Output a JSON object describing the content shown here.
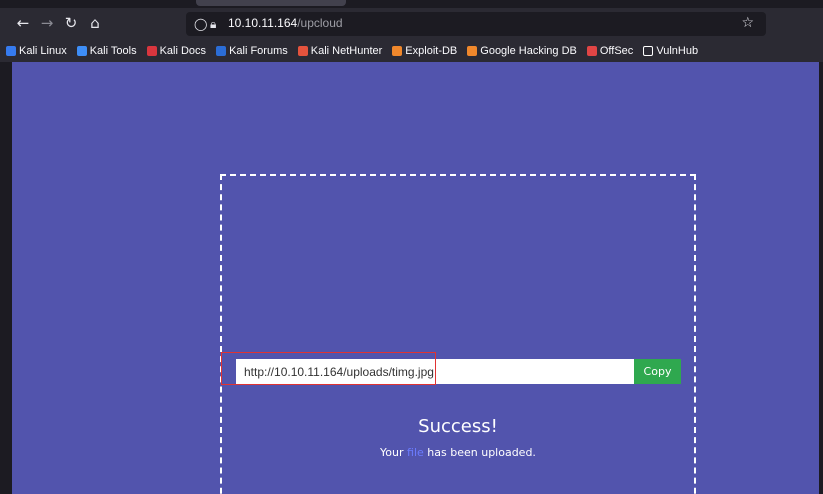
{
  "browser": {
    "url_host": "10.10.11.164",
    "url_path": "/upcloud",
    "nav_icons": [
      "arrow-left-icon",
      "arrow-right-icon",
      "reload-icon",
      "home-icon"
    ]
  },
  "bookmarks": [
    {
      "label": "Kali Linux",
      "color": "#367bf0"
    },
    {
      "label": "Kali Tools",
      "color": "#3e8ef7"
    },
    {
      "label": "Kali Docs",
      "color": "#d9363e"
    },
    {
      "label": "Kali Forums",
      "color": "#2b6dd6"
    },
    {
      "label": "Kali NetHunter",
      "color": "#e5533d"
    },
    {
      "label": "Exploit-DB",
      "color": "#f0882c"
    },
    {
      "label": "Google Hacking DB",
      "color": "#f0882c"
    },
    {
      "label": "OffSec",
      "color": "#e04545"
    },
    {
      "label": "VulnHub",
      "color": "#ffffff"
    }
  ],
  "page": {
    "background": "#5254ad",
    "title": "Success!",
    "message_before": "Your",
    "message_link": "file",
    "message_after": "has been uploaded.",
    "uploaded_url": "http://10.10.11.164/uploads/timg.jpg",
    "copy_label": "Copy"
  }
}
